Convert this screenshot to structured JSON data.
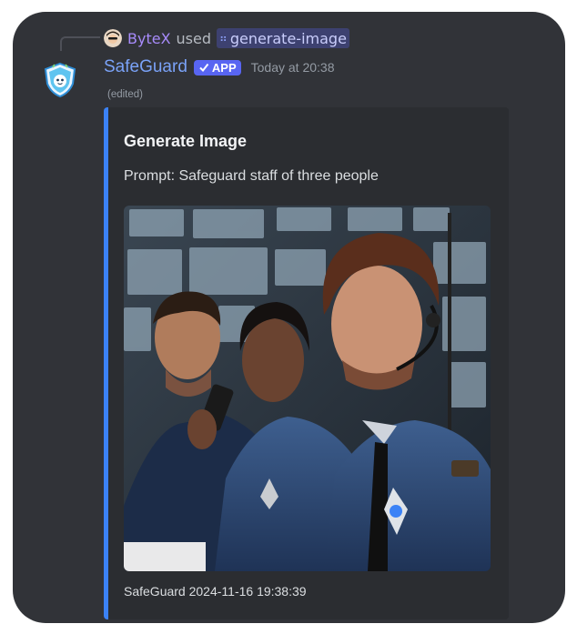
{
  "reply": {
    "username": "ByteX",
    "used": "used",
    "command": "generate-image"
  },
  "message": {
    "bot_name": "SafeGuard",
    "badge": "APP",
    "timestamp": "Today at 20:38",
    "edited": "(edited)"
  },
  "embed": {
    "title": "Generate Image",
    "description": "Prompt: Safeguard staff of three people",
    "footer": "SafeGuard 2024-11-16 19:38:39",
    "accent_color": "#3b82f6"
  },
  "colors": {
    "background": "#313338",
    "embed_background": "#2b2d31",
    "bot_name": "#7aa2f7",
    "badge": "#5865f2",
    "reply_user": "#a78bfa"
  }
}
